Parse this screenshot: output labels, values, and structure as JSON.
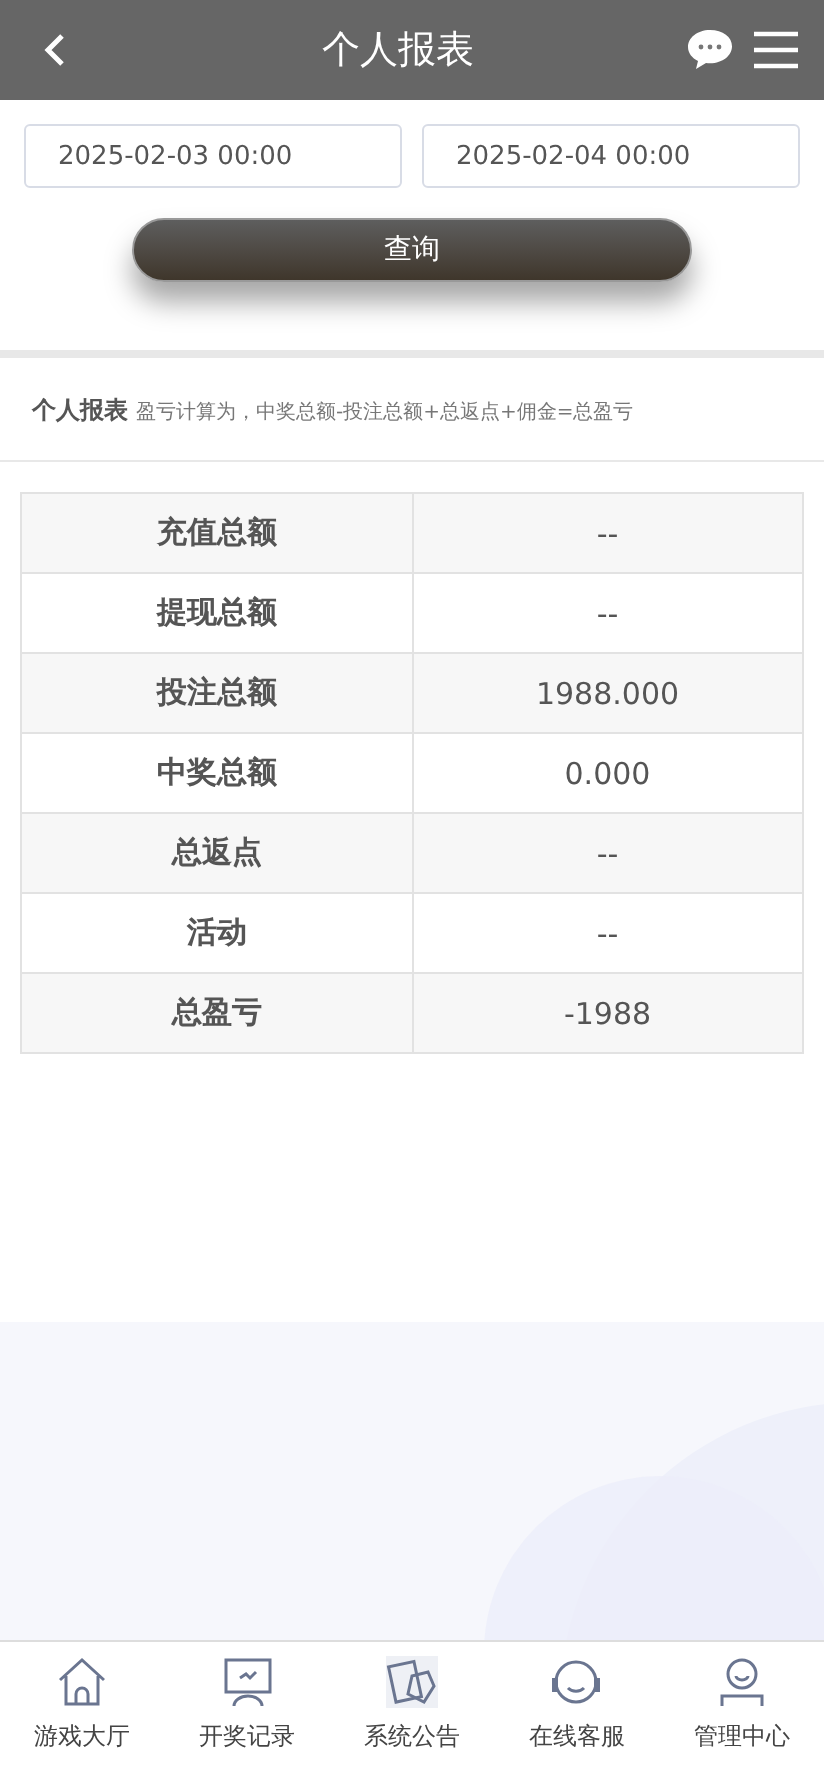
{
  "header": {
    "title": "个人报表"
  },
  "date_range": {
    "start": "2025-02-03 00:00",
    "end": "2025-02-04 00:00"
  },
  "query_button": "查询",
  "report_note": {
    "title": "个人报表",
    "formula": "盈亏计算为，中奖总额-投注总额+总返点+佣金=总盈亏"
  },
  "table": {
    "rows": [
      {
        "label": "充值总额",
        "value": "--"
      },
      {
        "label": "提现总额",
        "value": "--"
      },
      {
        "label": "投注总额",
        "value": "1988.000"
      },
      {
        "label": "中奖总额",
        "value": "0.000"
      },
      {
        "label": "总返点",
        "value": "--"
      },
      {
        "label": "活动",
        "value": "--"
      },
      {
        "label": "总盈亏",
        "value": "-1988"
      }
    ]
  },
  "bottom_nav": [
    {
      "kind": "home",
      "label": "游戏大厅"
    },
    {
      "kind": "monitor",
      "label": "开奖记录"
    },
    {
      "kind": "cards",
      "label": "系统公告"
    },
    {
      "kind": "headset",
      "label": "在线客服"
    },
    {
      "kind": "user",
      "label": "管理中心"
    }
  ]
}
